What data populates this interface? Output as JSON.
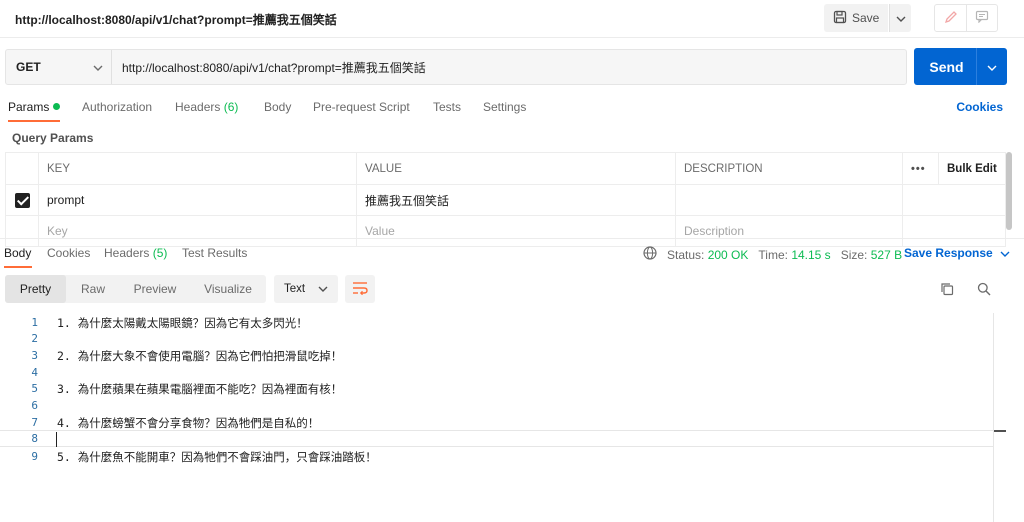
{
  "title_bar": {
    "request_title": "http://localhost:8080/api/v1/chat?prompt=推薦我五個笑話",
    "save_label": "Save"
  },
  "request": {
    "method": "GET",
    "url": "http://localhost:8080/api/v1/chat?prompt=推薦我五個笑話",
    "send_label": "Send"
  },
  "request_tabs": {
    "params": "Params",
    "authorization": "Authorization",
    "headers": "Headers",
    "headers_count": "(6)",
    "body": "Body",
    "pre_request_script": "Pre-request Script",
    "tests": "Tests",
    "settings": "Settings",
    "cookies": "Cookies"
  },
  "query_params": {
    "title": "Query Params",
    "columns": {
      "key": "KEY",
      "value": "VALUE",
      "description": "DESCRIPTION",
      "bulk_edit": "Bulk Edit"
    },
    "rows": [
      {
        "key": "prompt",
        "value": "推薦我五個笑話",
        "description": "",
        "checked": true
      }
    ],
    "placeholder": {
      "key": "Key",
      "value": "Value",
      "description": "Description"
    }
  },
  "response_tabs": {
    "body": "Body",
    "cookies": "Cookies",
    "headers": "Headers",
    "headers_count": "(5)",
    "test_results": "Test Results"
  },
  "response_status": {
    "status_label": "Status:",
    "status_value": "200 OK",
    "time_label": "Time:",
    "time_value": "14.15 s",
    "size_label": "Size:",
    "size_value": "527 B",
    "save_response": "Save Response"
  },
  "format_bar": {
    "pretty": "Pretty",
    "raw": "Raw",
    "preview": "Preview",
    "visualize": "Visualize",
    "language": "Text"
  },
  "response_body": {
    "lines": [
      {
        "n": "1",
        "text": "1. 為什麼太陽戴太陽眼鏡？因為它有太多閃光！"
      },
      {
        "n": "2",
        "text": ""
      },
      {
        "n": "3",
        "text": "2. 為什麼大象不會使用電腦？因為它們怕把滑鼠吃掉！"
      },
      {
        "n": "4",
        "text": ""
      },
      {
        "n": "5",
        "text": "3. 為什麼蘋果在蘋果電腦裡面不能吃？因為裡面有核！"
      },
      {
        "n": "6",
        "text": ""
      },
      {
        "n": "7",
        "text": "4. 為什麼螃蟹不會分享食物？因為牠們是自私的！"
      },
      {
        "n": "8",
        "text": ""
      },
      {
        "n": "9",
        "text": "5. 為什麼魚不能開車？因為牠們不會踩油門，只會踩油踏板！"
      }
    ]
  },
  "colors": {
    "accent": "#ff6c37",
    "send": "#0265d2",
    "success": "#0cbb52",
    "line_number": "#2c6ea3"
  },
  "icons": [
    "save-icon",
    "chevron-down-icon",
    "pencil-icon",
    "comment-icon",
    "globe-icon",
    "wrap-lines-icon",
    "copy-icon",
    "search-icon",
    "more-icon",
    "checkbox-checked-icon"
  ]
}
